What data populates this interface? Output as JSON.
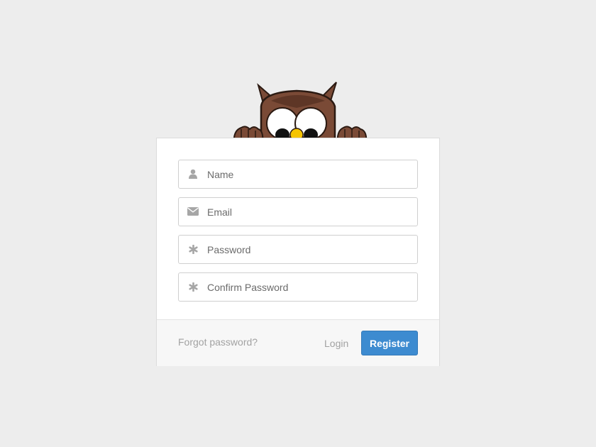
{
  "mascot": {
    "icon": "owl-mascot",
    "colors": {
      "body": "#7a4a36",
      "beak": "#f5c400"
    }
  },
  "form": {
    "fields": [
      {
        "icon": "user-icon",
        "placeholder": "Name",
        "value": ""
      },
      {
        "icon": "envelope-icon",
        "placeholder": "Email",
        "value": ""
      },
      {
        "icon": "asterisk-icon",
        "placeholder": "Password",
        "value": ""
      },
      {
        "icon": "asterisk-icon",
        "placeholder": "Confirm Password",
        "value": ""
      }
    ]
  },
  "footer": {
    "forgot_label": "Forgot password?",
    "login_label": "Login",
    "register_label": "Register"
  },
  "colors": {
    "background": "#ededed",
    "accent": "#3d8bd0",
    "muted_text": "#a2a2a2",
    "icon": "#a6a6a6"
  }
}
